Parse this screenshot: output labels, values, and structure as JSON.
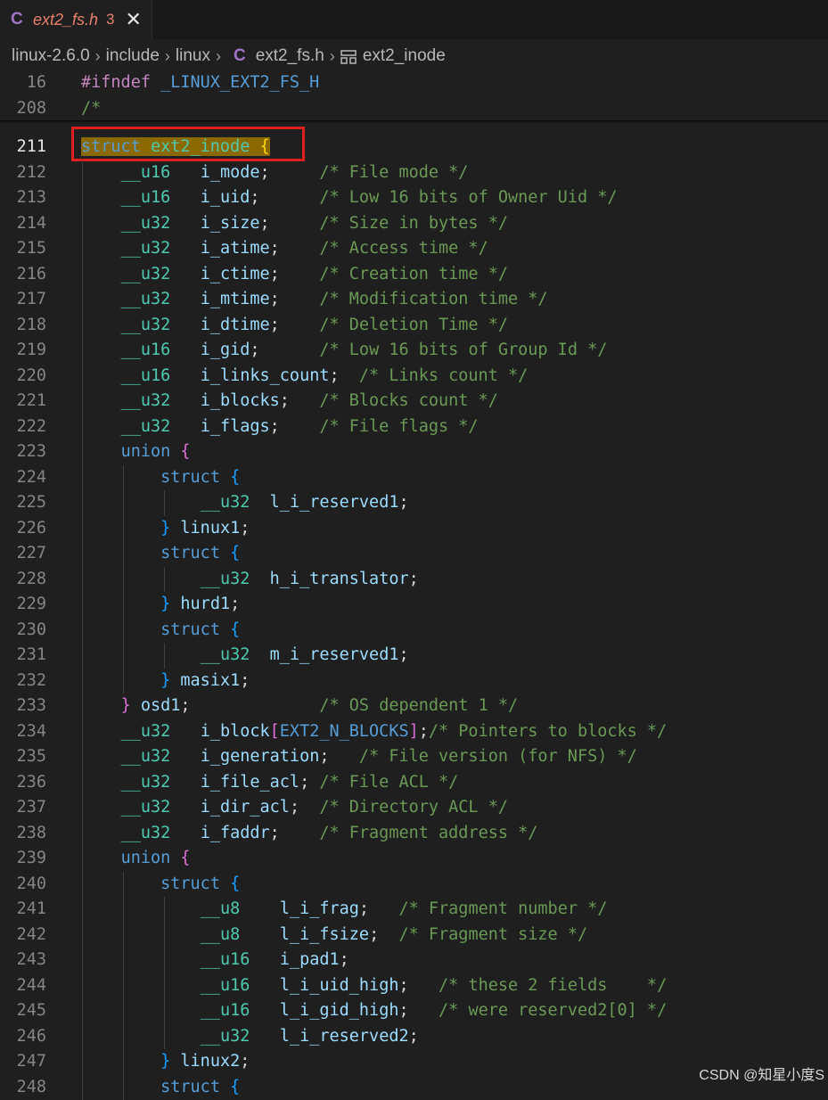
{
  "tab": {
    "icon": "C",
    "filename": "ext2_fs.h",
    "problem_count": "3",
    "close": "✕"
  },
  "breadcrumb": {
    "items": [
      "linux-2.6.0",
      "include",
      "linux",
      "ext2_fs.h",
      "ext2_inode"
    ],
    "file_icon": "C",
    "symbol_icon": "struct-symbol-icon"
  },
  "sticky": [
    {
      "num": "16",
      "text": "#ifndef _LINUX_EXT2_FS_H"
    },
    {
      "num": "208",
      "text": "/*"
    }
  ],
  "lines": [
    {
      "num": "211",
      "text": "struct ext2_inode {"
    },
    {
      "num": "212",
      "text": "    __u16   i_mode;     /* File mode */"
    },
    {
      "num": "213",
      "text": "    __u16   i_uid;      /* Low 16 bits of Owner Uid */"
    },
    {
      "num": "214",
      "text": "    __u32   i_size;     /* Size in bytes */"
    },
    {
      "num": "215",
      "text": "    __u32   i_atime;    /* Access time */"
    },
    {
      "num": "216",
      "text": "    __u32   i_ctime;    /* Creation time */"
    },
    {
      "num": "217",
      "text": "    __u32   i_mtime;    /* Modification time */"
    },
    {
      "num": "218",
      "text": "    __u32   i_dtime;    /* Deletion Time */"
    },
    {
      "num": "219",
      "text": "    __u16   i_gid;      /* Low 16 bits of Group Id */"
    },
    {
      "num": "220",
      "text": "    __u16   i_links_count;  /* Links count */"
    },
    {
      "num": "221",
      "text": "    __u32   i_blocks;   /* Blocks count */"
    },
    {
      "num": "222",
      "text": "    __u32   i_flags;    /* File flags */"
    },
    {
      "num": "223",
      "text": "    union {"
    },
    {
      "num": "224",
      "text": "        struct {"
    },
    {
      "num": "225",
      "text": "            __u32  l_i_reserved1;"
    },
    {
      "num": "226",
      "text": "        } linux1;"
    },
    {
      "num": "227",
      "text": "        struct {"
    },
    {
      "num": "228",
      "text": "            __u32  h_i_translator;"
    },
    {
      "num": "229",
      "text": "        } hurd1;"
    },
    {
      "num": "230",
      "text": "        struct {"
    },
    {
      "num": "231",
      "text": "            __u32  m_i_reserved1;"
    },
    {
      "num": "232",
      "text": "        } masix1;"
    },
    {
      "num": "233",
      "text": "    } osd1;             /* OS dependent 1 */"
    },
    {
      "num": "234",
      "text": "    __u32   i_block[EXT2_N_BLOCKS];/* Pointers to blocks */"
    },
    {
      "num": "235",
      "text": "    __u32   i_generation;   /* File version (for NFS) */"
    },
    {
      "num": "236",
      "text": "    __u32   i_file_acl; /* File ACL */"
    },
    {
      "num": "237",
      "text": "    __u32   i_dir_acl;  /* Directory ACL */"
    },
    {
      "num": "238",
      "text": "    __u32   i_faddr;    /* Fragment address */"
    },
    {
      "num": "239",
      "text": "    union {"
    },
    {
      "num": "240",
      "text": "        struct {"
    },
    {
      "num": "241",
      "text": "            __u8    l_i_frag;   /* Fragment number */"
    },
    {
      "num": "242",
      "text": "            __u8    l_i_fsize;  /* Fragment size */"
    },
    {
      "num": "243",
      "text": "            __u16   i_pad1;"
    },
    {
      "num": "244",
      "text": "            __u16   l_i_uid_high;   /* these 2 fields    */"
    },
    {
      "num": "245",
      "text": "            __u16   l_i_gid_high;   /* were reserved2[0] */"
    },
    {
      "num": "246",
      "text": "            __u32   l_i_reserved2;"
    },
    {
      "num": "247",
      "text": "        } linux2;"
    },
    {
      "num": "248",
      "text": "        struct {"
    }
  ],
  "active_line": "211",
  "watermark": "CSDN @知星小度S",
  "colors": {
    "keyword": "#569cd6",
    "type": "#4ec9b0",
    "identifier": "#9cdcfe",
    "comment": "#6a9955",
    "highlight_box": "#e02020",
    "background": "#1f1f1f"
  }
}
